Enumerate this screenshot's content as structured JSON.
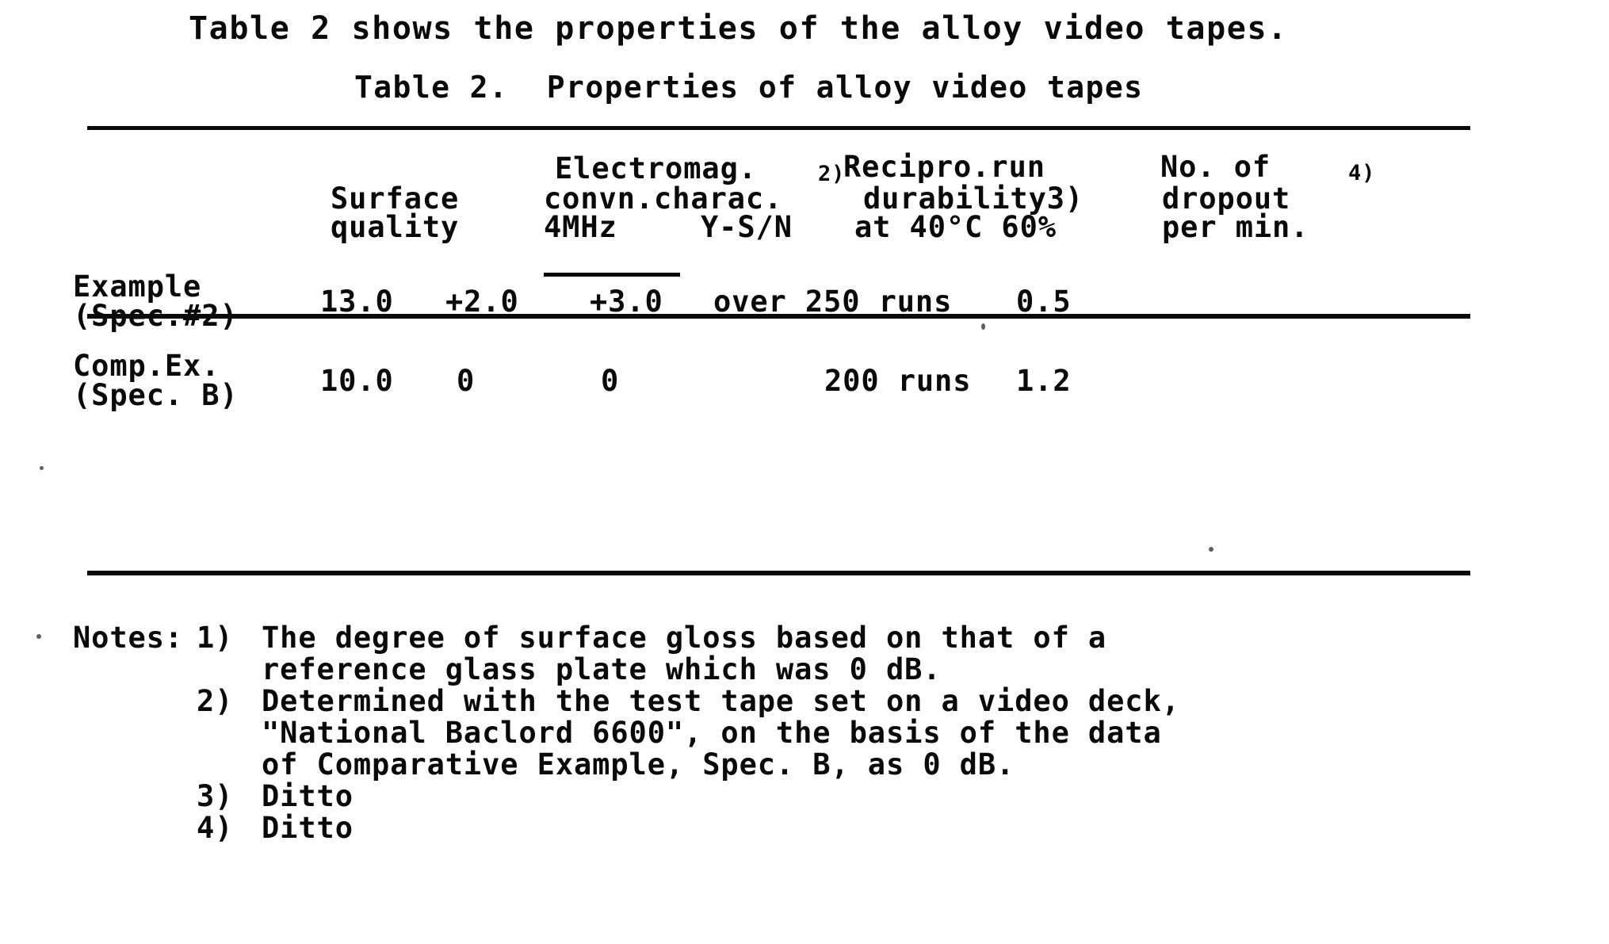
{
  "document": {
    "intro_line": "Table 2 shows the properties of the alloy video tapes.",
    "caption": "Table 2.  Properties of alloy video tapes"
  },
  "table": {
    "header": {
      "line1": {
        "electromag": "Electromag.",
        "sup_electromag": "2)",
        "recipro": "Recipro.run",
        "no_of": "No. of",
        "sup_dropout": "4)"
      },
      "line2": {
        "surface": "Surface",
        "convn_charac": "convn.charac.",
        "durability": "durability3)",
        "dropout": "dropout",
        "sup_dropout": "4)"
      },
      "line3": {
        "quality": "quality",
        "freq_4mhz": "4MHz",
        "y_sn": "Y-S/N",
        "conditions": "at 40°C 60%",
        "per_min": "per min."
      }
    },
    "columns": [
      "Surface quality",
      "Electromag. convn.charac. 4MHz",
      "Electromag. convn.charac. Y-S/N",
      "Recipro.run durability at 40°C 60%",
      "No. of dropout per min."
    ],
    "rows": [
      {
        "label_line1": "Example",
        "label_line2": "(Spec.#2)",
        "surface_quality": "13.0",
        "mhz_4": "+2.0",
        "y_sn": "+3.0",
        "durability": "over 250 runs",
        "dropout": "0.5"
      },
      {
        "label_line1": "Comp.Ex.",
        "label_line2": "(Spec. B)",
        "surface_quality": "10.0",
        "mhz_4": "0",
        "y_sn": "0",
        "durability": "200 runs",
        "dropout": "1.2"
      }
    ]
  },
  "notes": {
    "heading": "Notes:",
    "items": [
      {
        "marker": "1)",
        "lines": [
          "The degree of surface gloss based on that of a",
          "reference glass plate which was 0 dB."
        ]
      },
      {
        "marker": "2)",
        "lines": [
          "Determined with the test tape set on a video deck,",
          "\"National Baclord 6600\", on the basis of the data",
          "of Comparative Example, Spec. B, as 0 dB."
        ]
      },
      {
        "marker": "3)",
        "lines": [
          "Ditto"
        ]
      },
      {
        "marker": "4)",
        "lines": [
          "Ditto"
        ]
      }
    ]
  }
}
